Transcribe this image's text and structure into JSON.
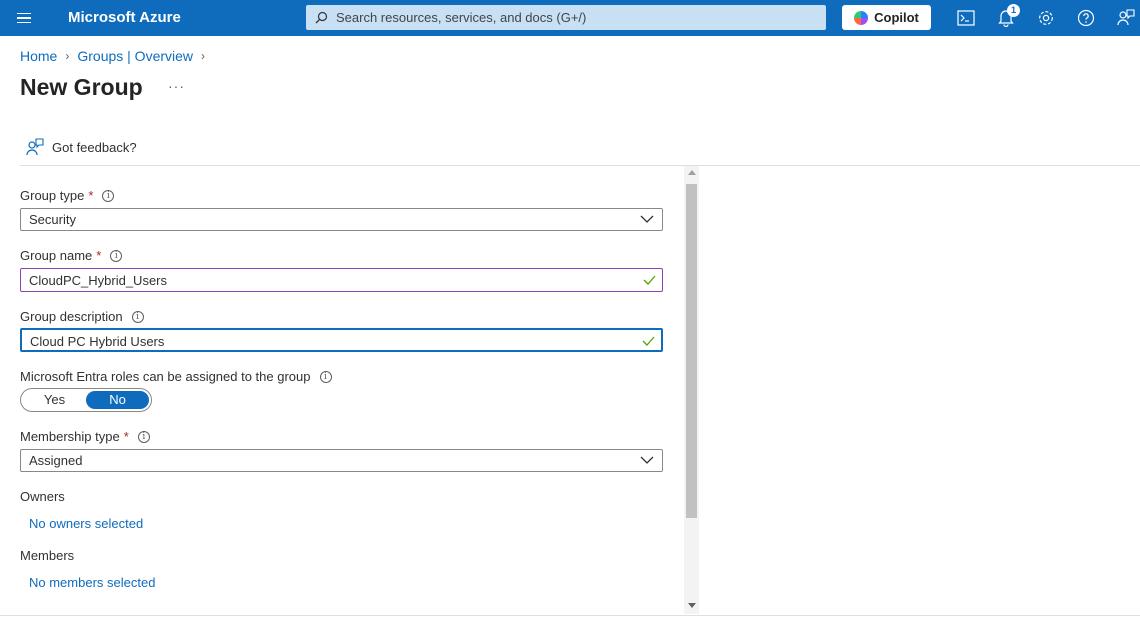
{
  "topbar": {
    "brand": "Microsoft Azure",
    "search_placeholder": "Search resources, services, and docs (G+/)",
    "copilot_label": "Copilot",
    "notification_count": "1",
    "bar_color": "#0f6cbd"
  },
  "breadcrumb": {
    "items": [
      "Home",
      "Groups | Overview"
    ]
  },
  "page": {
    "title": "New Group",
    "more_label": "···",
    "feedback_label": "Got feedback?"
  },
  "form": {
    "group_type": {
      "label": "Group type",
      "required_mark": "*",
      "value": "Security"
    },
    "group_name": {
      "label": "Group name",
      "required_mark": "*",
      "value": "CloudPC_Hybrid_Users"
    },
    "group_description": {
      "label": "Group description",
      "value": "Cloud PC Hybrid Users"
    },
    "entra_roles": {
      "label": "Microsoft Entra roles can be assigned to the group",
      "yes": "Yes",
      "no": "No",
      "selected": "No"
    },
    "membership_type": {
      "label": "Membership type",
      "required_mark": "*",
      "value": "Assigned"
    },
    "owners": {
      "label": "Owners",
      "link": "No owners selected"
    },
    "members": {
      "label": "Members",
      "link": "No members selected"
    }
  }
}
